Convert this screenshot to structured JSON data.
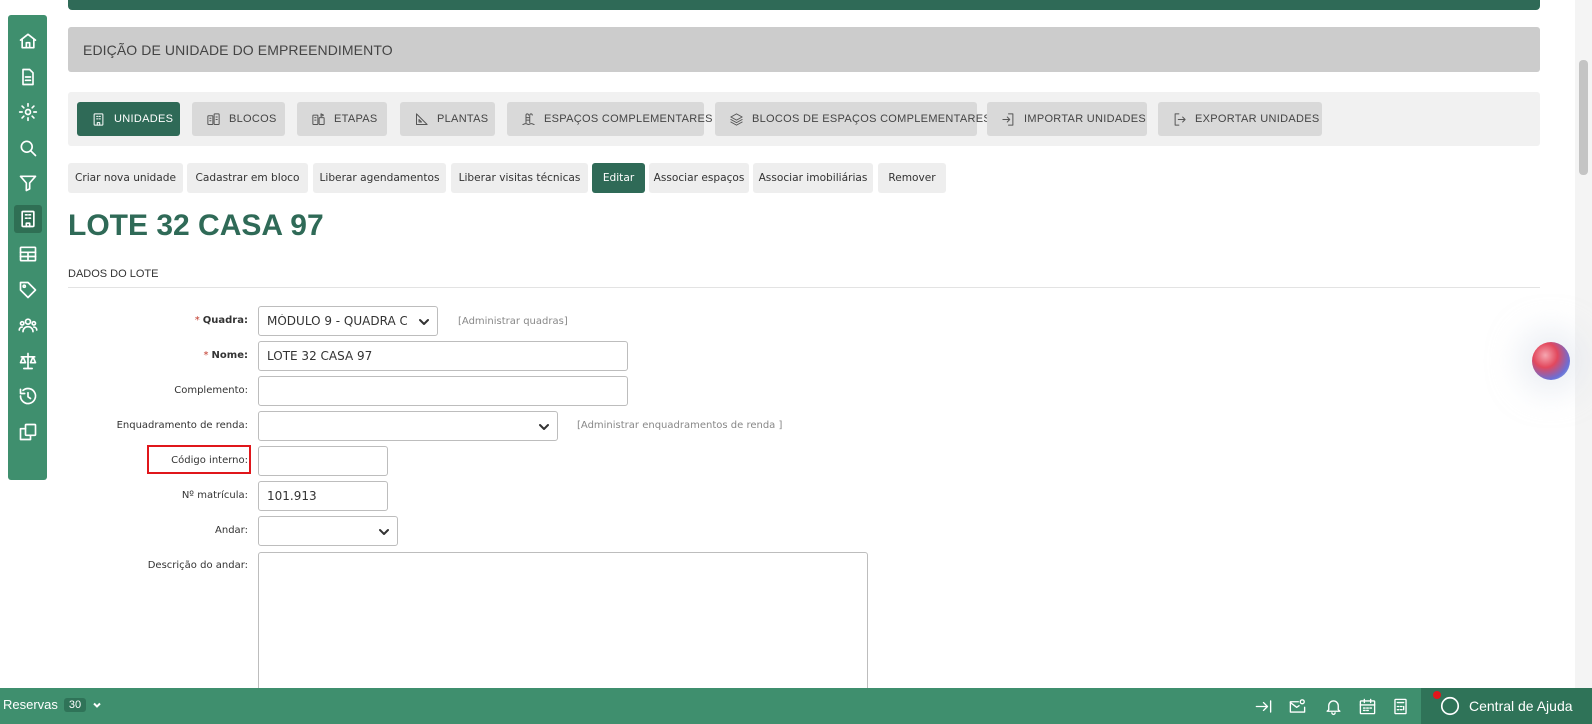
{
  "sidebar": {
    "items": [
      {
        "icon": "home-icon"
      },
      {
        "icon": "document-icon"
      },
      {
        "icon": "gear-icon"
      },
      {
        "icon": "search-icon"
      },
      {
        "icon": "filter-icon"
      },
      {
        "icon": "building-icon",
        "active": true
      },
      {
        "icon": "table-icon"
      },
      {
        "icon": "tag-icon"
      },
      {
        "icon": "users-icon"
      },
      {
        "icon": "scale-icon"
      },
      {
        "icon": "history-icon"
      },
      {
        "icon": "copy-icon"
      }
    ]
  },
  "header": {
    "title": "EDIÇÃO DE UNIDADE DO EMPREENDIMENTO"
  },
  "tabs": [
    {
      "label": "UNIDADES",
      "icon": "building-icon",
      "active": true
    },
    {
      "label": "BLOCOS",
      "icon": "blocks-icon"
    },
    {
      "label": "ETAPAS",
      "icon": "stages-icon"
    },
    {
      "label": "PLANTAS",
      "icon": "ruler-icon"
    },
    {
      "label": "ESPAÇOS COMPLEMENTARES",
      "icon": "pool-icon"
    },
    {
      "label": "BLOCOS DE ESPAÇOS COMPLEMENTARES",
      "icon": "layers-icon"
    },
    {
      "label": "IMPORTAR UNIDADES",
      "icon": "import-icon"
    },
    {
      "label": "EXPORTAR UNIDADES",
      "icon": "export-icon"
    }
  ],
  "actions": [
    {
      "label": "Criar nova unidade"
    },
    {
      "label": "Cadastrar em bloco"
    },
    {
      "label": "Liberar agendamentos"
    },
    {
      "label": "Liberar visitas técnicas"
    },
    {
      "label": "Editar",
      "active": true
    },
    {
      "label": "Associar espaços"
    },
    {
      "label": "Associar imobiliárias"
    },
    {
      "label": "Remover"
    }
  ],
  "unit": {
    "title": "LOTE 32 CASA 97",
    "section": "DADOS DO LOTE"
  },
  "form": {
    "required_mark": "*",
    "quadra": {
      "label": "Quadra:",
      "value": "MÓDULO 9 - QUADRA C",
      "admin_link": "[Administrar quadras]"
    },
    "nome": {
      "label": "Nome:",
      "value": "LOTE 32  CASA  97"
    },
    "complemento": {
      "label": "Complemento:",
      "value": ""
    },
    "enquadramento": {
      "label": "Enquadramento de renda:",
      "value": "",
      "admin_link": "[Administrar enquadramentos de renda ]"
    },
    "codigo_interno": {
      "label": "Código interno:",
      "value": ""
    },
    "matricula": {
      "label": "Nº matrícula:",
      "value": "101.913"
    },
    "andar": {
      "label": "Andar:",
      "value": ""
    },
    "descricao_andar": {
      "label": "Descrição do andar:",
      "value": ""
    }
  },
  "bottom_bar": {
    "reservas_label": "Reservas",
    "reservas_count": "30",
    "help_label": "Central de Ajuda"
  }
}
